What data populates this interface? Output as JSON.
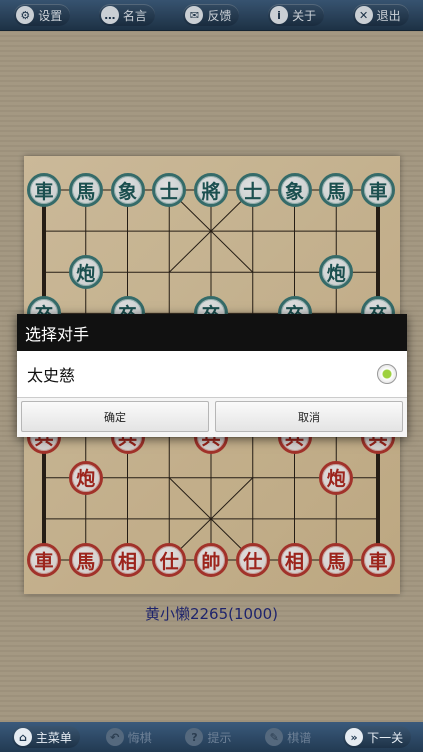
{
  "toolbar": {
    "items": [
      {
        "label": "设置",
        "icon": "gear-icon",
        "glyph": "⚙"
      },
      {
        "label": "名言",
        "icon": "speech-bubble-icon",
        "glyph": "…"
      },
      {
        "label": "反馈",
        "icon": "mail-icon",
        "glyph": "✉"
      },
      {
        "label": "关于",
        "icon": "info-icon",
        "glyph": "i"
      },
      {
        "label": "退出",
        "icon": "close-icon",
        "glyph": "✕"
      }
    ]
  },
  "board": {
    "black_pieces": [
      {
        "char": "車",
        "col": 0,
        "row": 0
      },
      {
        "char": "馬",
        "col": 1,
        "row": 0
      },
      {
        "char": "象",
        "col": 2,
        "row": 0
      },
      {
        "char": "士",
        "col": 3,
        "row": 0
      },
      {
        "char": "將",
        "col": 4,
        "row": 0
      },
      {
        "char": "士",
        "col": 5,
        "row": 0
      },
      {
        "char": "象",
        "col": 6,
        "row": 0
      },
      {
        "char": "馬",
        "col": 7,
        "row": 0
      },
      {
        "char": "車",
        "col": 8,
        "row": 0
      },
      {
        "char": "炮",
        "col": 1,
        "row": 2
      },
      {
        "char": "炮",
        "col": 7,
        "row": 2
      },
      {
        "char": "卒",
        "col": 0,
        "row": 3
      },
      {
        "char": "卒",
        "col": 2,
        "row": 3
      },
      {
        "char": "卒",
        "col": 4,
        "row": 3
      },
      {
        "char": "卒",
        "col": 6,
        "row": 3
      },
      {
        "char": "卒",
        "col": 8,
        "row": 3
      }
    ],
    "red_pieces": [
      {
        "char": "兵",
        "col": 0,
        "row": 6
      },
      {
        "char": "兵",
        "col": 2,
        "row": 6
      },
      {
        "char": "兵",
        "col": 4,
        "row": 6
      },
      {
        "char": "兵",
        "col": 6,
        "row": 6
      },
      {
        "char": "兵",
        "col": 8,
        "row": 6
      },
      {
        "char": "炮",
        "col": 1,
        "row": 7
      },
      {
        "char": "炮",
        "col": 7,
        "row": 7
      },
      {
        "char": "車",
        "col": 0,
        "row": 9
      },
      {
        "char": "馬",
        "col": 1,
        "row": 9
      },
      {
        "char": "相",
        "col": 2,
        "row": 9
      },
      {
        "char": "仕",
        "col": 3,
        "row": 9
      },
      {
        "char": "帥",
        "col": 4,
        "row": 9
      },
      {
        "char": "仕",
        "col": 5,
        "row": 9
      },
      {
        "char": "相",
        "col": 6,
        "row": 9
      },
      {
        "char": "馬",
        "col": 7,
        "row": 9
      },
      {
        "char": "車",
        "col": 8,
        "row": 9
      }
    ]
  },
  "player": {
    "name": "黄小懒2265(1000)"
  },
  "dialog": {
    "title": "选择对手",
    "option": "太史慈",
    "option_selected": true,
    "confirm_label": "确定",
    "cancel_label": "取消"
  },
  "bottombar": {
    "items": [
      {
        "label": "主菜单",
        "icon": "home-icon",
        "glyph": "⌂",
        "enabled": true
      },
      {
        "label": "悔棋",
        "icon": "undo-icon",
        "glyph": "↶",
        "enabled": false
      },
      {
        "label": "提示",
        "icon": "bulb-icon",
        "glyph": "?",
        "enabled": false
      },
      {
        "label": "棋谱",
        "icon": "pencil-icon",
        "glyph": "✎",
        "enabled": false
      },
      {
        "label": "下一关",
        "icon": "next-icon",
        "glyph": "»",
        "enabled": true
      }
    ]
  }
}
